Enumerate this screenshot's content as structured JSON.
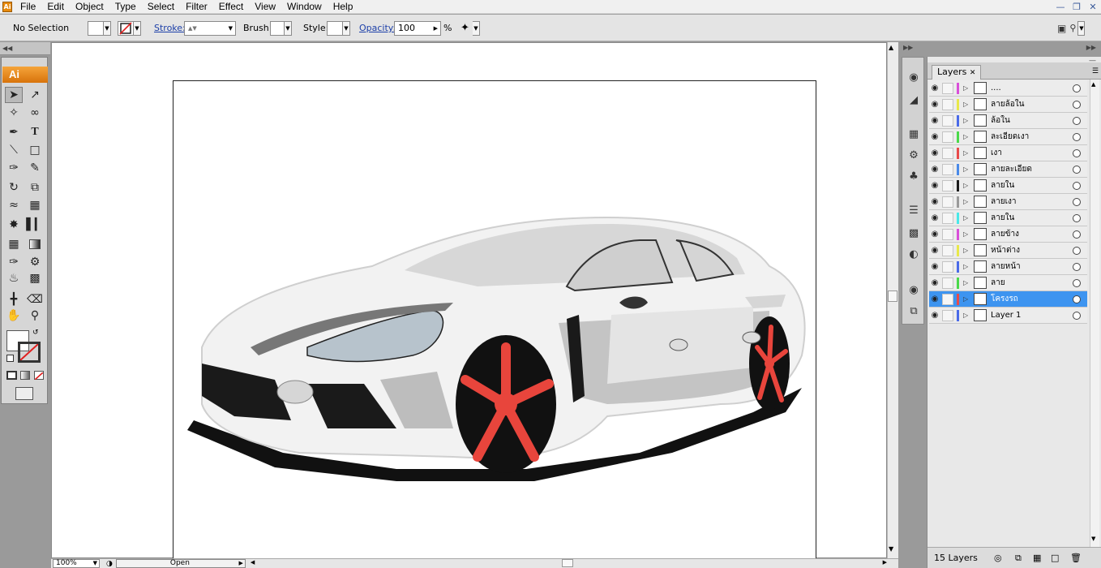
{
  "menubar": {
    "items": [
      "File",
      "Edit",
      "Object",
      "Type",
      "Select",
      "Filter",
      "Effect",
      "View",
      "Window",
      "Help"
    ],
    "app_icon": "Ai"
  },
  "controlbar": {
    "selection_label": "No Selection",
    "stroke_label": "Stroke:",
    "brush_label": "Brush:",
    "style_label": "Style:",
    "opacity_label": "Opacity:",
    "opacity_value": "100",
    "percent": "%"
  },
  "toolbox": {
    "badge": "Ai",
    "icons": [
      "selection-icon",
      "direct-selection-icon",
      "magic-wand-icon",
      "lasso-icon",
      "pen-icon",
      "type-icon",
      "line-icon",
      "rectangle-icon",
      "paintbrush-icon",
      "pencil-icon",
      "rotate-icon",
      "scale-icon",
      "warp-icon",
      "free-transform-icon",
      "symbol-sprayer-icon",
      "graph-icon",
      "mesh-icon",
      "gradient-icon",
      "eyedropper-icon",
      "blend-icon",
      "live-paint-icon",
      "live-paint-selection-icon",
      "slice-icon",
      "eraser-icon",
      "hand-icon",
      "zoom-icon"
    ]
  },
  "statusbar": {
    "zoom": "100%",
    "status": "Open"
  },
  "layers": {
    "tab_label": "Layers",
    "count_label": "15 Layers",
    "rows": [
      {
        "name": "....",
        "color": "#d94fd9"
      },
      {
        "name": "ลายล้อใน",
        "color": "#e8e84a"
      },
      {
        "name": "ล้อใน",
        "color": "#4a6ae8"
      },
      {
        "name": "ละเอียดเงา",
        "color": "#4ad94a"
      },
      {
        "name": "เงา",
        "color": "#e84a4a"
      },
      {
        "name": "ลายละเอียด",
        "color": "#4a8ae8"
      },
      {
        "name": "ลายใน",
        "color": "#1a1a1a"
      },
      {
        "name": "ลายเงา",
        "color": "#9a9a9a"
      },
      {
        "name": "ลายใน",
        "color": "#4ae8e8"
      },
      {
        "name": "ลายข้าง",
        "color": "#d94fd9"
      },
      {
        "name": "หน้าต่าง",
        "color": "#e8e84a"
      },
      {
        "name": "ลายหน้า",
        "color": "#4a6ae8"
      },
      {
        "name": "ลาย",
        "color": "#4ad94a"
      },
      {
        "name": "โครงรถ",
        "color": "#e84a4a",
        "selected": true
      },
      {
        "name": "Layer 1",
        "color": "#4a6ae8"
      }
    ]
  }
}
